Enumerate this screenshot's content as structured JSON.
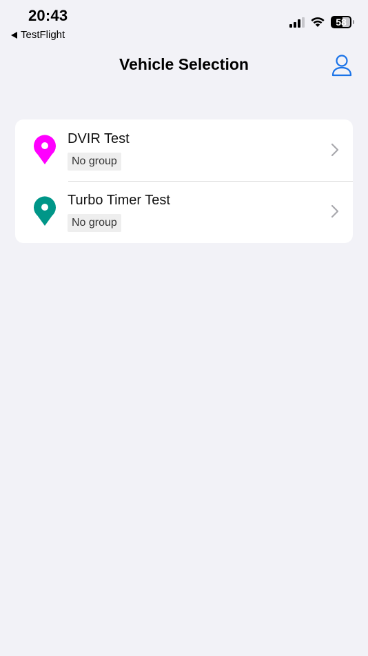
{
  "status_bar": {
    "time": "20:43",
    "back_app": "TestFlight",
    "battery": "58",
    "signal_icon": "cellular-signal-icon",
    "wifi_icon": "wifi-icon"
  },
  "nav": {
    "title": "Vehicle Selection",
    "profile_icon": "person-icon"
  },
  "vehicles": [
    {
      "name": "DVIR Test",
      "group": "No group",
      "pin_color": "#ff00ff"
    },
    {
      "name": "Turbo Timer Test",
      "group": "No group",
      "pin_color": "#009688"
    }
  ],
  "colors": {
    "accent": "#1a73e8",
    "background": "#f2f2f7"
  }
}
